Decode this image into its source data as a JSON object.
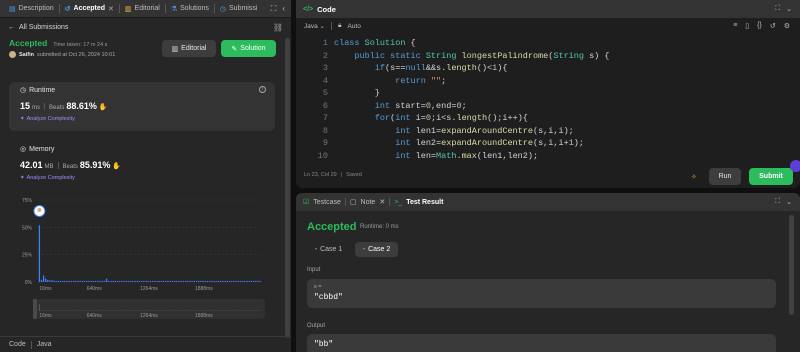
{
  "left": {
    "tabs": [
      {
        "label": "Description",
        "icon": "description-icon"
      },
      {
        "label": "Accepted",
        "icon": "history-icon"
      },
      {
        "label": "Editorial",
        "icon": "book-icon"
      },
      {
        "label": "Solutions",
        "icon": "flask-icon"
      },
      {
        "label": "Submissi",
        "icon": "clock-icon"
      }
    ],
    "back_label": "All Submissions",
    "status": "Accepted",
    "time_taken": "Time taken: 17 m 24 s",
    "user": "Saifin",
    "submitted_text": "submitted at Oct 26, 2024 10:01",
    "editorial_btn": "Editorial",
    "solution_btn": "Solution",
    "runtime": {
      "title": "Runtime",
      "value": "15",
      "unit": "ms",
      "beats_label": "Beats",
      "beats": "88.61%",
      "analyze": "Analyze Complexity"
    },
    "memory": {
      "title": "Memory",
      "value": "42.01",
      "unit": "MB",
      "beats_label": "Beats",
      "beats": "85.91%",
      "analyze": "Analyze Complexity"
    },
    "footer": {
      "code_label": "Code",
      "lang": "Java"
    }
  },
  "chart_data": [
    {
      "type": "bar",
      "title": "",
      "xlabel": "",
      "ylabel": "",
      "y_ticks": [
        "75%",
        "50%",
        "25%",
        "0%"
      ],
      "ylim": [
        0,
        75
      ],
      "x_ticks": [
        "16ms",
        "640ms",
        "1264ms",
        "1888ms"
      ],
      "xlim_ms": [
        0,
        2550
      ],
      "bar_color": "#3b82f6",
      "highlight_x_ms": 16,
      "bars": [
        {
          "x": 16,
          "y": 52
        },
        {
          "x": 40,
          "y": 2
        },
        {
          "x": 64,
          "y": 6
        },
        {
          "x": 88,
          "y": 3
        },
        {
          "x": 112,
          "y": 2
        },
        {
          "x": 136,
          "y": 1.5
        },
        {
          "x": 160,
          "y": 1.5
        },
        {
          "x": 184,
          "y": 1.2
        },
        {
          "x": 208,
          "y": 1
        },
        {
          "x": 232,
          "y": 1
        },
        {
          "x": 256,
          "y": 1
        },
        {
          "x": 280,
          "y": 1
        },
        {
          "x": 304,
          "y": 1
        },
        {
          "x": 330,
          "y": 1
        },
        {
          "x": 355,
          "y": 1
        },
        {
          "x": 380,
          "y": 1
        },
        {
          "x": 405,
          "y": 1
        },
        {
          "x": 430,
          "y": 1
        },
        {
          "x": 455,
          "y": 1
        },
        {
          "x": 480,
          "y": 1
        },
        {
          "x": 505,
          "y": 1
        },
        {
          "x": 530,
          "y": 1
        },
        {
          "x": 555,
          "y": 1
        },
        {
          "x": 580,
          "y": 1
        },
        {
          "x": 605,
          "y": 1
        },
        {
          "x": 630,
          "y": 1
        },
        {
          "x": 655,
          "y": 1
        },
        {
          "x": 680,
          "y": 1
        },
        {
          "x": 705,
          "y": 1
        },
        {
          "x": 730,
          "y": 1
        },
        {
          "x": 755,
          "y": 1
        },
        {
          "x": 780,
          "y": 3
        },
        {
          "x": 805,
          "y": 1
        },
        {
          "x": 830,
          "y": 1
        },
        {
          "x": 855,
          "y": 1
        },
        {
          "x": 880,
          "y": 1
        },
        {
          "x": 905,
          "y": 1
        },
        {
          "x": 930,
          "y": 1
        },
        {
          "x": 955,
          "y": 1
        },
        {
          "x": 980,
          "y": 1
        },
        {
          "x": 1005,
          "y": 1
        },
        {
          "x": 1030,
          "y": 1
        },
        {
          "x": 1055,
          "y": 1
        },
        {
          "x": 1080,
          "y": 1
        },
        {
          "x": 1105,
          "y": 1
        },
        {
          "x": 1130,
          "y": 1
        },
        {
          "x": 1155,
          "y": 1
        },
        {
          "x": 1180,
          "y": 1
        },
        {
          "x": 1205,
          "y": 1
        },
        {
          "x": 1230,
          "y": 1
        },
        {
          "x": 1255,
          "y": 1
        },
        {
          "x": 1280,
          "y": 1
        },
        {
          "x": 1305,
          "y": 1
        },
        {
          "x": 1330,
          "y": 1
        },
        {
          "x": 1355,
          "y": 1
        },
        {
          "x": 1380,
          "y": 1
        },
        {
          "x": 1405,
          "y": 1
        },
        {
          "x": 1430,
          "y": 1
        },
        {
          "x": 1455,
          "y": 1
        },
        {
          "x": 1480,
          "y": 1
        },
        {
          "x": 1505,
          "y": 1
        },
        {
          "x": 1530,
          "y": 1
        },
        {
          "x": 1555,
          "y": 1
        },
        {
          "x": 1580,
          "y": 1
        },
        {
          "x": 1605,
          "y": 1
        },
        {
          "x": 1630,
          "y": 1
        },
        {
          "x": 1655,
          "y": 1
        },
        {
          "x": 1680,
          "y": 1
        },
        {
          "x": 1705,
          "y": 1
        },
        {
          "x": 1730,
          "y": 1
        },
        {
          "x": 1755,
          "y": 1
        },
        {
          "x": 1780,
          "y": 1
        },
        {
          "x": 1805,
          "y": 1
        },
        {
          "x": 1830,
          "y": 1
        },
        {
          "x": 1855,
          "y": 1
        },
        {
          "x": 1880,
          "y": 1
        },
        {
          "x": 1905,
          "y": 1
        },
        {
          "x": 1930,
          "y": 1
        },
        {
          "x": 1955,
          "y": 1
        },
        {
          "x": 1980,
          "y": 1
        },
        {
          "x": 2005,
          "y": 1
        },
        {
          "x": 2030,
          "y": 1
        },
        {
          "x": 2055,
          "y": 1
        },
        {
          "x": 2080,
          "y": 1
        },
        {
          "x": 2105,
          "y": 1
        },
        {
          "x": 2130,
          "y": 1
        },
        {
          "x": 2155,
          "y": 1
        },
        {
          "x": 2180,
          "y": 1
        },
        {
          "x": 2205,
          "y": 1
        },
        {
          "x": 2230,
          "y": 1
        },
        {
          "x": 2255,
          "y": 1
        },
        {
          "x": 2280,
          "y": 1
        },
        {
          "x": 2305,
          "y": 1
        },
        {
          "x": 2330,
          "y": 1
        },
        {
          "x": 2355,
          "y": 1
        },
        {
          "x": 2380,
          "y": 1
        },
        {
          "x": 2405,
          "y": 1
        },
        {
          "x": 2430,
          "y": 1
        },
        {
          "x": 2455,
          "y": 1
        },
        {
          "x": 2480,
          "y": 1
        },
        {
          "x": 2505,
          "y": 1
        },
        {
          "x": 2530,
          "y": 1
        }
      ]
    }
  ],
  "code": {
    "title": "Code",
    "lang": "Java",
    "mode": "Auto",
    "status": "Ln 23, Col 29",
    "saved": "Saved",
    "run_btn": "Run",
    "submit_btn": "Submit",
    "lines": [
      {
        "n": "1",
        "t": "class Solution {"
      },
      {
        "n": "2",
        "t": "    public static String longestPalindrome(String s) {"
      },
      {
        "n": "3",
        "t": "        if(s==null&&s.length()<1){"
      },
      {
        "n": "4",
        "t": "            return \"\";"
      },
      {
        "n": "5",
        "t": "        }"
      },
      {
        "n": "6",
        "t": "        int start=0,end=0;"
      },
      {
        "n": "7",
        "t": "        for(int i=0;i<s.length();i++){"
      },
      {
        "n": "8",
        "t": "            int len1=expandAroundCentre(s,i,i);"
      },
      {
        "n": "9",
        "t": "            int len2=expandAroundCentre(s,i,i+1);"
      },
      {
        "n": "10",
        "t": "            int len=Math.max(len1,len2);"
      }
    ]
  },
  "test": {
    "tabs": [
      "Testcase",
      "Note",
      "Test Result"
    ],
    "status": "Accepted",
    "runtime": "Runtime: 0 ms",
    "cases": [
      "Case 1",
      "Case 2"
    ],
    "input_label": "Input",
    "input_var": "s =",
    "input_val": "\"cbbd\"",
    "output_label": "Output",
    "output_val": "\"bb\""
  }
}
